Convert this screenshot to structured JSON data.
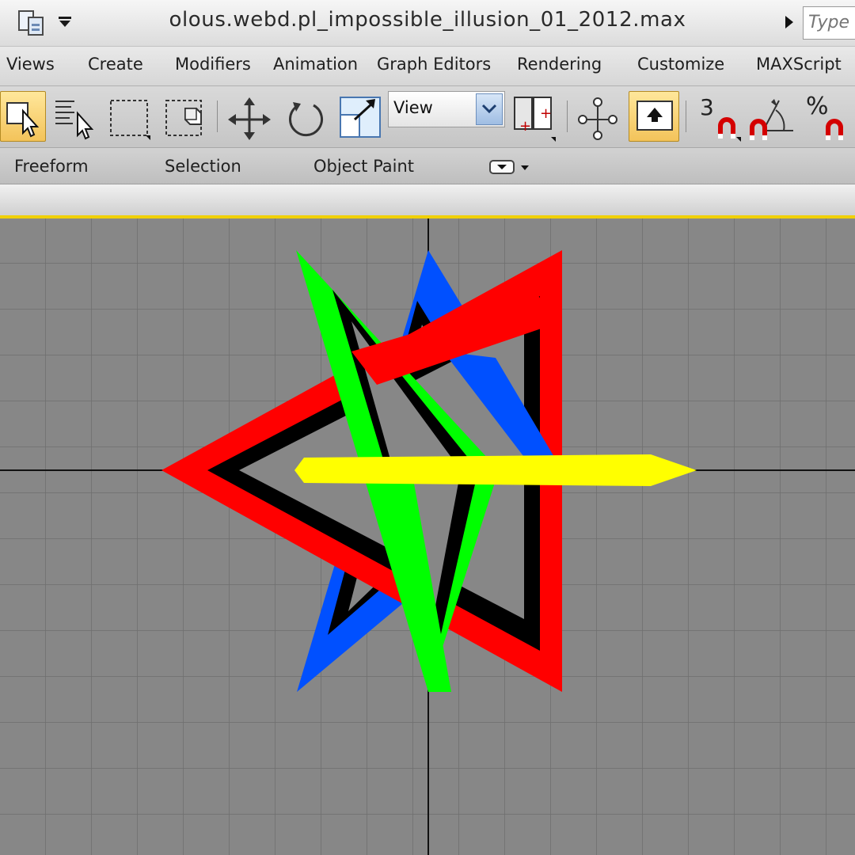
{
  "titlebar": {
    "title": "olous.webd.pl_impossible_illusion_01_2012.max",
    "search_placeholder": "Type"
  },
  "menu": {
    "items": [
      "Views",
      "Create",
      "Modifiers",
      "Animation",
      "Graph Editors",
      "Rendering",
      "Customize",
      "MAXScript"
    ]
  },
  "toolbar": {
    "reference_coordinate": "View",
    "snap_angle_label": "3",
    "percent_label": "%"
  },
  "ribbon": {
    "tabs": [
      "Freeform",
      "Selection",
      "Object Paint"
    ]
  },
  "viewport": {
    "accent": "#f0d000",
    "background": "#878787",
    "grid_color": "#6f6f6f",
    "object_colors": {
      "red": "#ff0000",
      "green": "#00ff00",
      "blue": "#0050ff",
      "yellow": "#ffff00",
      "black": "#000000"
    }
  }
}
